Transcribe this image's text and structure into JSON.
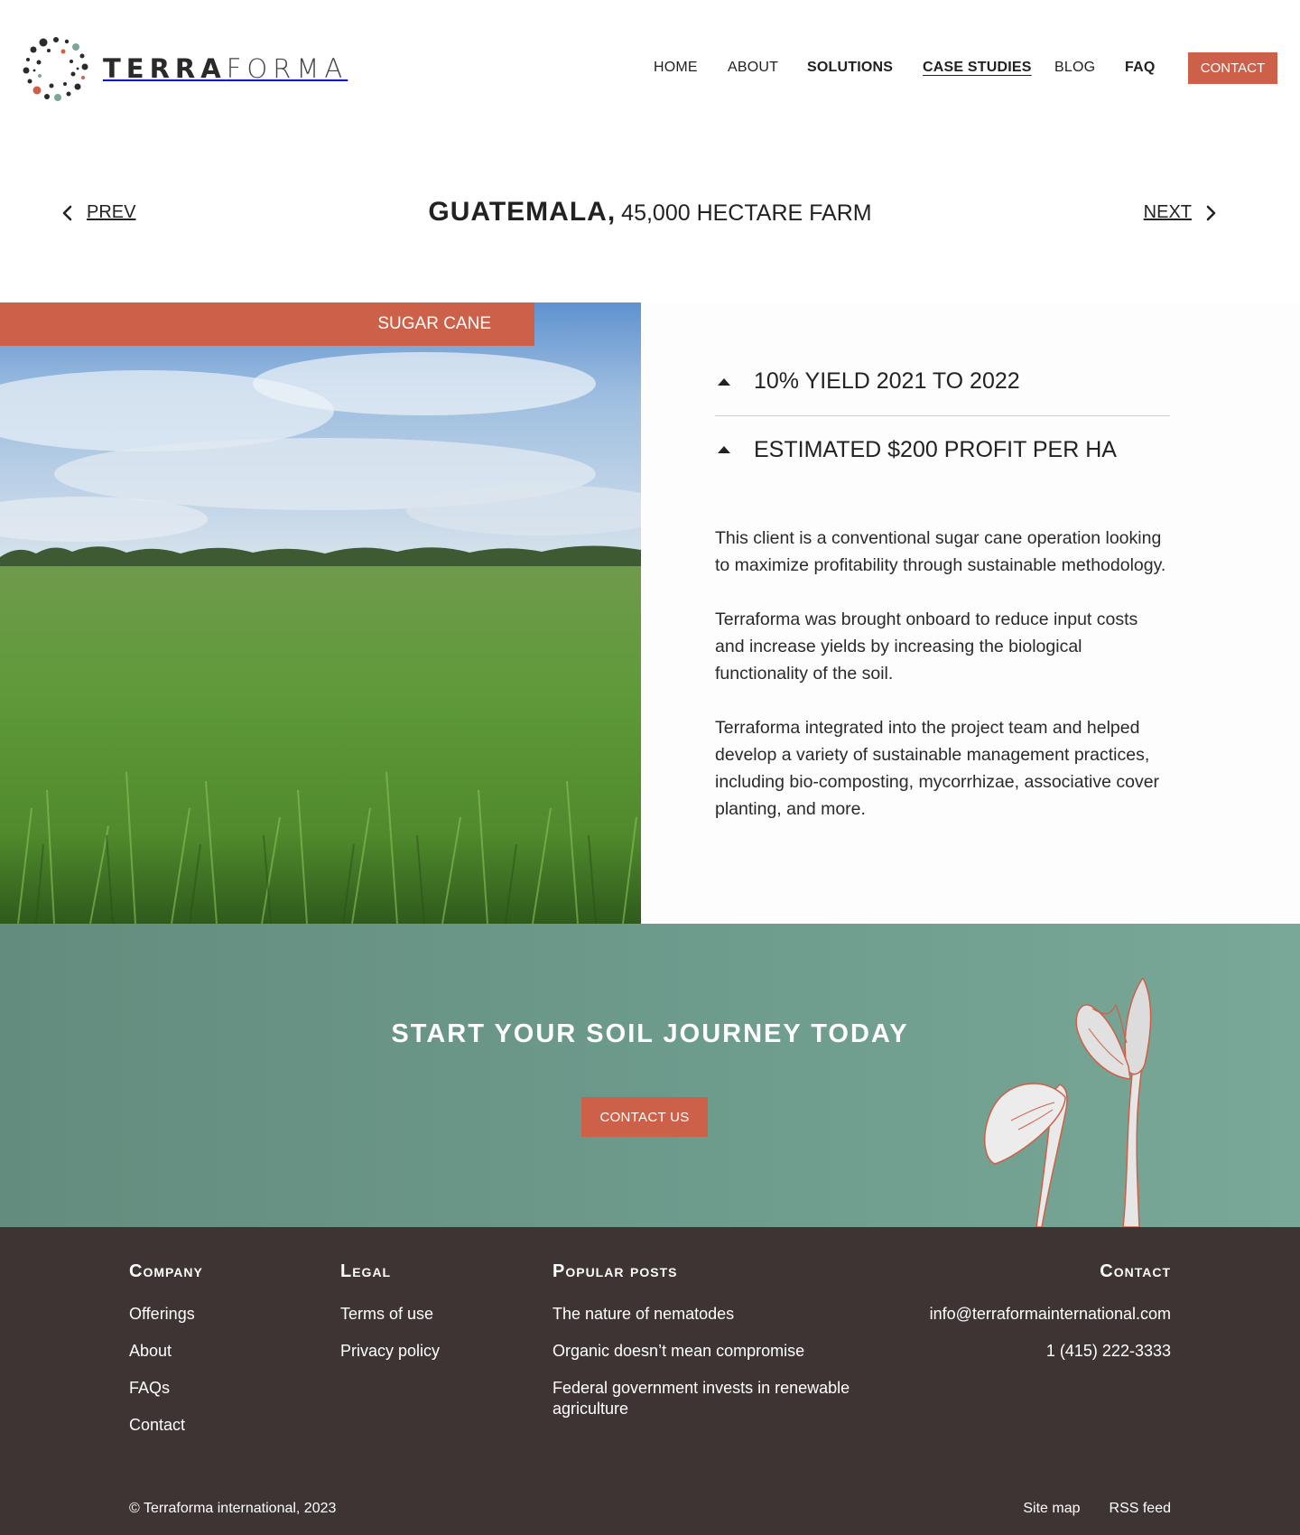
{
  "brand": {
    "name_bold": "TERRA",
    "name_light": "FORMA",
    "accent_color": "#cd6048",
    "teal_color": "#6c9a8b",
    "footer_color": "#3d3433"
  },
  "nav": {
    "items": [
      {
        "label": "HOME"
      },
      {
        "label": "ABOUT"
      },
      {
        "label": "SOLUTIONS"
      },
      {
        "label": "CASE STUDIES"
      },
      {
        "label": "BLOG"
      },
      {
        "label": "FAQ"
      }
    ],
    "active": "CASE STUDIES",
    "contact_label": "CONTACT"
  },
  "case": {
    "prev_label": "PREV",
    "next_label": "NEXT",
    "country": "GUATEMALA,",
    "subtitle": "45,000 HECTARE FARM",
    "crop_tag": "SUGAR CANE",
    "stats": [
      {
        "label": "10% YIELD 2021 TO 2022"
      },
      {
        "label": "ESTIMATED $200 PROFIT PER HA"
      }
    ],
    "paragraphs": [
      "This client is a conventional sugar cane operation looking to maximize profitability through sustainable methodology.",
      "Terraforma was brought onboard to reduce input costs and increase yields by increasing the biological functionality of the soil.",
      "Terraforma integrated into the project team and helped develop a variety of sustainable management practices, including bio-composting, mycorrhizae, associative cover planting, and more."
    ]
  },
  "cta": {
    "title": "START YOUR SOIL JOURNEY TODAY",
    "button_label": "CONTACT US"
  },
  "footer": {
    "company": {
      "heading": "Company",
      "links": [
        "Offerings",
        "About",
        "FAQs",
        "Contact"
      ]
    },
    "legal": {
      "heading": "Legal",
      "links": [
        "Terms of use",
        "Privacy policy"
      ]
    },
    "popular": {
      "heading": "Popular posts",
      "links": [
        "The nature of nematodes",
        "Organic doesn’t mean compromise",
        "Federal government invests in renewable agriculture"
      ]
    },
    "contact": {
      "heading": "Contact",
      "email": "info@terraformainternational.com",
      "phone": "1 (415) 222-3333"
    },
    "copyright": "© Terraforma international, 2023",
    "bottom_links": [
      "Site map",
      "RSS feed"
    ]
  }
}
